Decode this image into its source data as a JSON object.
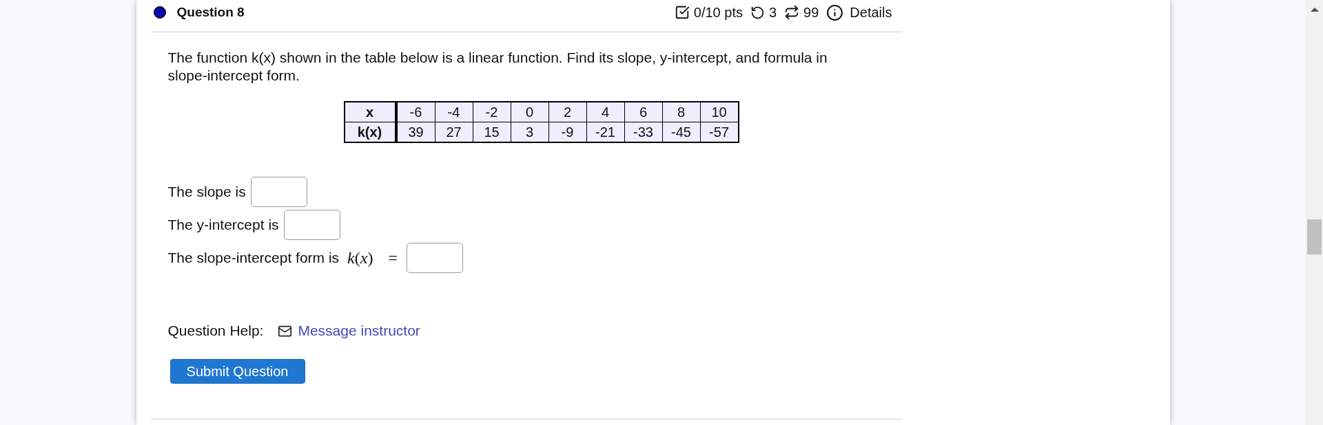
{
  "question": {
    "title": "Question 8",
    "score": "0/10 pts",
    "retries": "3",
    "attempts": "99",
    "details": "Details"
  },
  "prompt": "The function k(x) shown in the table below is a linear function. Find its slope, y-intercept, and formula in slope-intercept form.",
  "table": {
    "rows": [
      {
        "header": "x",
        "cells": [
          "-6",
          "-4",
          "-2",
          "0",
          "2",
          "4",
          "6",
          "8",
          "10"
        ]
      },
      {
        "header": "k(x)",
        "cells": [
          "39",
          "27",
          "15",
          "3",
          "-9",
          "-21",
          "-33",
          "-45",
          "-57"
        ]
      }
    ]
  },
  "answers": [
    {
      "label": "The slope is"
    },
    {
      "label": "The y-intercept is"
    },
    {
      "label": "The slope-intercept form is",
      "math": "*k*(*x*) ="
    }
  ],
  "help": {
    "label": "Question Help:",
    "link": "Message instructor"
  },
  "submit": "Submit Question"
}
